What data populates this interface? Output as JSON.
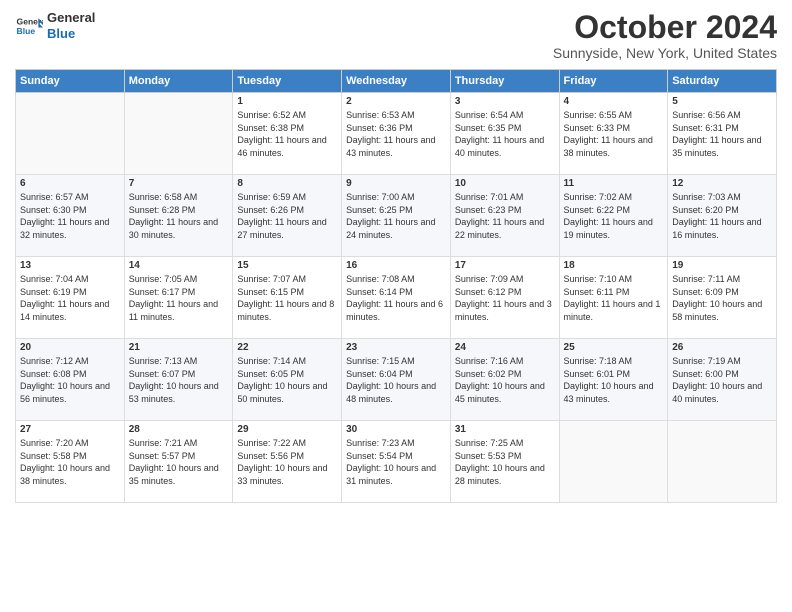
{
  "header": {
    "logo_line1": "General",
    "logo_line2": "Blue",
    "month_title": "October 2024",
    "location": "Sunnyside, New York, United States"
  },
  "weekdays": [
    "Sunday",
    "Monday",
    "Tuesday",
    "Wednesday",
    "Thursday",
    "Friday",
    "Saturday"
  ],
  "weeks": [
    [
      {
        "day": "",
        "info": ""
      },
      {
        "day": "",
        "info": ""
      },
      {
        "day": "1",
        "info": "Sunrise: 6:52 AM\nSunset: 6:38 PM\nDaylight: 11 hours and 46 minutes."
      },
      {
        "day": "2",
        "info": "Sunrise: 6:53 AM\nSunset: 6:36 PM\nDaylight: 11 hours and 43 minutes."
      },
      {
        "day": "3",
        "info": "Sunrise: 6:54 AM\nSunset: 6:35 PM\nDaylight: 11 hours and 40 minutes."
      },
      {
        "day": "4",
        "info": "Sunrise: 6:55 AM\nSunset: 6:33 PM\nDaylight: 11 hours and 38 minutes."
      },
      {
        "day": "5",
        "info": "Sunrise: 6:56 AM\nSunset: 6:31 PM\nDaylight: 11 hours and 35 minutes."
      }
    ],
    [
      {
        "day": "6",
        "info": "Sunrise: 6:57 AM\nSunset: 6:30 PM\nDaylight: 11 hours and 32 minutes."
      },
      {
        "day": "7",
        "info": "Sunrise: 6:58 AM\nSunset: 6:28 PM\nDaylight: 11 hours and 30 minutes."
      },
      {
        "day": "8",
        "info": "Sunrise: 6:59 AM\nSunset: 6:26 PM\nDaylight: 11 hours and 27 minutes."
      },
      {
        "day": "9",
        "info": "Sunrise: 7:00 AM\nSunset: 6:25 PM\nDaylight: 11 hours and 24 minutes."
      },
      {
        "day": "10",
        "info": "Sunrise: 7:01 AM\nSunset: 6:23 PM\nDaylight: 11 hours and 22 minutes."
      },
      {
        "day": "11",
        "info": "Sunrise: 7:02 AM\nSunset: 6:22 PM\nDaylight: 11 hours and 19 minutes."
      },
      {
        "day": "12",
        "info": "Sunrise: 7:03 AM\nSunset: 6:20 PM\nDaylight: 11 hours and 16 minutes."
      }
    ],
    [
      {
        "day": "13",
        "info": "Sunrise: 7:04 AM\nSunset: 6:19 PM\nDaylight: 11 hours and 14 minutes."
      },
      {
        "day": "14",
        "info": "Sunrise: 7:05 AM\nSunset: 6:17 PM\nDaylight: 11 hours and 11 minutes."
      },
      {
        "day": "15",
        "info": "Sunrise: 7:07 AM\nSunset: 6:15 PM\nDaylight: 11 hours and 8 minutes."
      },
      {
        "day": "16",
        "info": "Sunrise: 7:08 AM\nSunset: 6:14 PM\nDaylight: 11 hours and 6 minutes."
      },
      {
        "day": "17",
        "info": "Sunrise: 7:09 AM\nSunset: 6:12 PM\nDaylight: 11 hours and 3 minutes."
      },
      {
        "day": "18",
        "info": "Sunrise: 7:10 AM\nSunset: 6:11 PM\nDaylight: 11 hours and 1 minute."
      },
      {
        "day": "19",
        "info": "Sunrise: 7:11 AM\nSunset: 6:09 PM\nDaylight: 10 hours and 58 minutes."
      }
    ],
    [
      {
        "day": "20",
        "info": "Sunrise: 7:12 AM\nSunset: 6:08 PM\nDaylight: 10 hours and 56 minutes."
      },
      {
        "day": "21",
        "info": "Sunrise: 7:13 AM\nSunset: 6:07 PM\nDaylight: 10 hours and 53 minutes."
      },
      {
        "day": "22",
        "info": "Sunrise: 7:14 AM\nSunset: 6:05 PM\nDaylight: 10 hours and 50 minutes."
      },
      {
        "day": "23",
        "info": "Sunrise: 7:15 AM\nSunset: 6:04 PM\nDaylight: 10 hours and 48 minutes."
      },
      {
        "day": "24",
        "info": "Sunrise: 7:16 AM\nSunset: 6:02 PM\nDaylight: 10 hours and 45 minutes."
      },
      {
        "day": "25",
        "info": "Sunrise: 7:18 AM\nSunset: 6:01 PM\nDaylight: 10 hours and 43 minutes."
      },
      {
        "day": "26",
        "info": "Sunrise: 7:19 AM\nSunset: 6:00 PM\nDaylight: 10 hours and 40 minutes."
      }
    ],
    [
      {
        "day": "27",
        "info": "Sunrise: 7:20 AM\nSunset: 5:58 PM\nDaylight: 10 hours and 38 minutes."
      },
      {
        "day": "28",
        "info": "Sunrise: 7:21 AM\nSunset: 5:57 PM\nDaylight: 10 hours and 35 minutes."
      },
      {
        "day": "29",
        "info": "Sunrise: 7:22 AM\nSunset: 5:56 PM\nDaylight: 10 hours and 33 minutes."
      },
      {
        "day": "30",
        "info": "Sunrise: 7:23 AM\nSunset: 5:54 PM\nDaylight: 10 hours and 31 minutes."
      },
      {
        "day": "31",
        "info": "Sunrise: 7:25 AM\nSunset: 5:53 PM\nDaylight: 10 hours and 28 minutes."
      },
      {
        "day": "",
        "info": ""
      },
      {
        "day": "",
        "info": ""
      }
    ]
  ]
}
